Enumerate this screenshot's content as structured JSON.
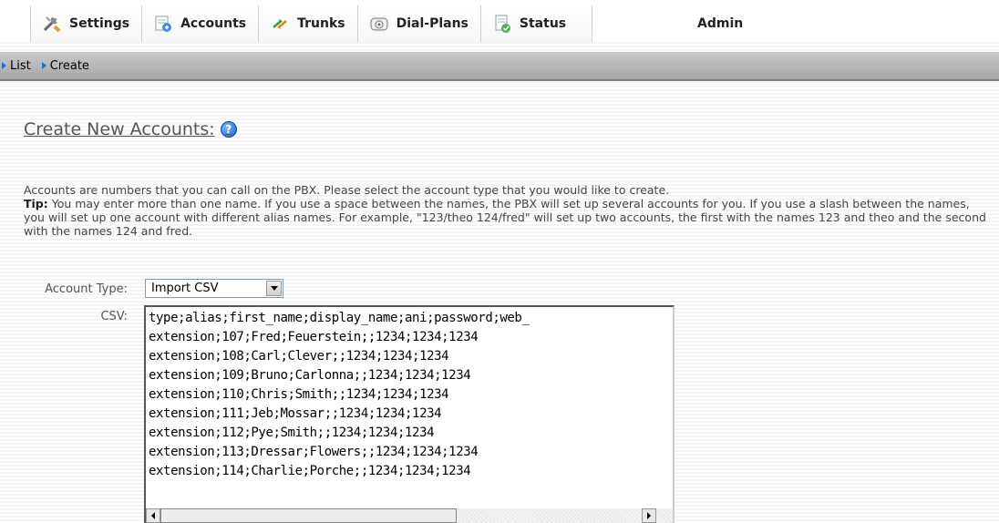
{
  "tabs": [
    {
      "label": "Settings",
      "icon": "settings-icon"
    },
    {
      "label": "Accounts",
      "icon": "accounts-icon"
    },
    {
      "label": "Trunks",
      "icon": "trunks-icon"
    },
    {
      "label": "Dial-Plans",
      "icon": "dial-plans-icon"
    },
    {
      "label": "Status",
      "icon": "status-icon"
    }
  ],
  "user": {
    "label": "Admin"
  },
  "subnav": [
    {
      "label": "List"
    },
    {
      "label": "Create"
    }
  ],
  "page": {
    "title": "Create New Accounts:",
    "help_icon": "help-icon",
    "help_glyph": "?"
  },
  "description": {
    "line1": "Accounts are numbers that you can call on the PBX. Please select the account type that you would like to create.",
    "tip_label": "Tip:",
    "tip_text": " You may enter more than one name. If you use a space between the names, the PBX will set up several accounts for you. If you use a slash between the names, you will set up one account with different alias names. For example, \"123/theo 124/fred\" will set up two accounts, the first with the names 123 and theo and the second with the names 124 and fred."
  },
  "form": {
    "account_type_label": "Account Type:",
    "account_type_value": "Import CSV",
    "csv_label": "CSV:",
    "csv_lines": [
      "type;alias;first_name;display_name;ani;password;web_",
      "extension;107;Fred;Feuerstein;;1234;1234;1234",
      "extension;108;Carl;Clever;;1234;1234;1234",
      "extension;109;Bruno;Carlonna;;1234;1234;1234",
      "extension;110;Chris;Smith;;1234;1234;1234",
      "extension;111;Jeb;Mossar;;1234;1234;1234",
      "extension;112;Pye;Smith;;1234;1234;1234",
      "extension;113;Dressar;Flowers;;1234;1234;1234",
      "extension;114;Charlie;Porche;;1234;1234;1234"
    ]
  },
  "colors": {
    "accent": "#1f6fd1",
    "subnav_bg": "#b5b5b5",
    "heading": "#555555"
  }
}
